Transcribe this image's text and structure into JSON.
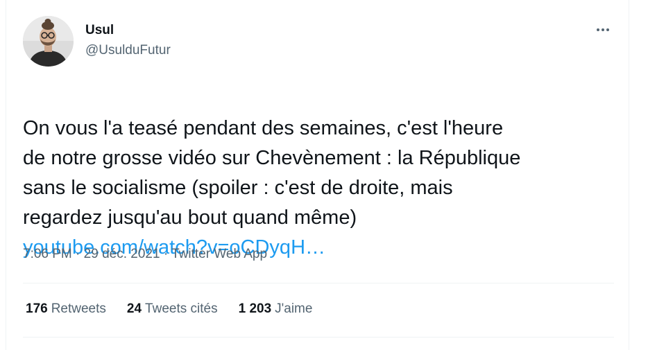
{
  "author": {
    "display_name": "Usul",
    "handle": "@UsulduFutur"
  },
  "tweet": {
    "text": "On vous l'a teasé pendant des semaines, c'est l'heure\nde notre grosse vidéo sur Chevènement : la République\nsans le socialisme (spoiler : c'est de droite, mais\nregardez jusqu'au bout quand même)",
    "link": "youtube.com/watch?v=oCDyqH…"
  },
  "meta": {
    "time": "7:06 PM",
    "separator": "·",
    "date": "29 déc. 2021",
    "source": "Twitter Web App"
  },
  "stats": {
    "retweets_count": "176",
    "retweets_label": "Retweets",
    "quotes_count": "24",
    "quotes_label": "Tweets cités",
    "likes_count": "1 203",
    "likes_label": "J'aime"
  },
  "colors": {
    "link": "#1d9bf0",
    "secondary_text": "#536471",
    "primary_text": "#0f1419",
    "divider": "#eff3f4"
  },
  "icons": {
    "more": "more-horizontal-icon"
  }
}
